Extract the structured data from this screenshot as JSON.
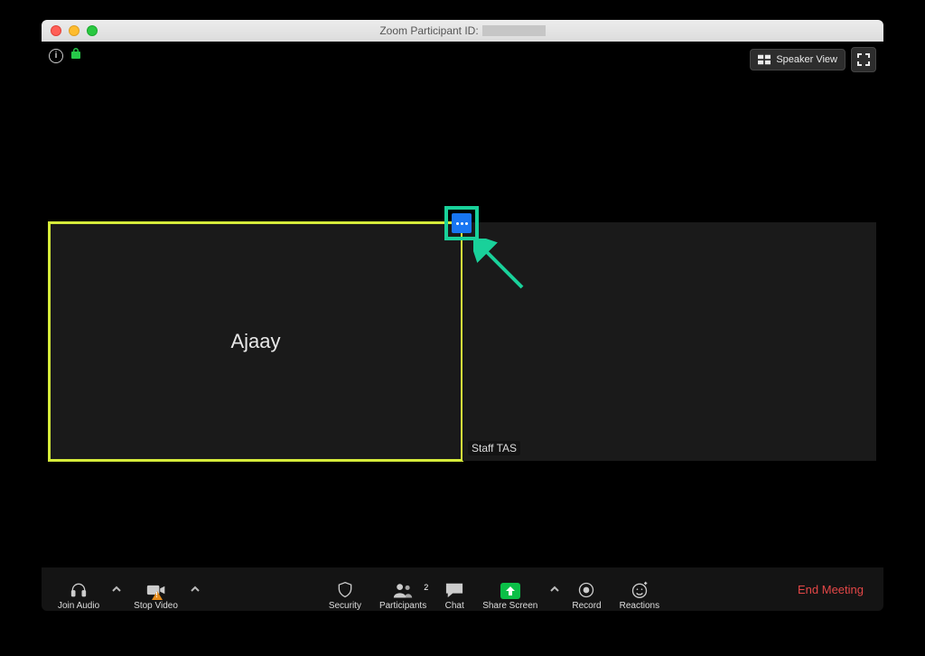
{
  "window": {
    "title_prefix": "Zoom Participant ID:"
  },
  "view_toggle": {
    "label": "Speaker View"
  },
  "tiles": {
    "active_name": "Ajaay",
    "other_label": "Staff TAS"
  },
  "toolbar": {
    "join_audio": "Join Audio",
    "stop_video": "Stop Video",
    "security": "Security",
    "participants": "Participants",
    "participants_count": "2",
    "chat": "Chat",
    "share_screen": "Share Screen",
    "record": "Record",
    "reactions": "Reactions",
    "end_meeting": "End Meeting"
  }
}
